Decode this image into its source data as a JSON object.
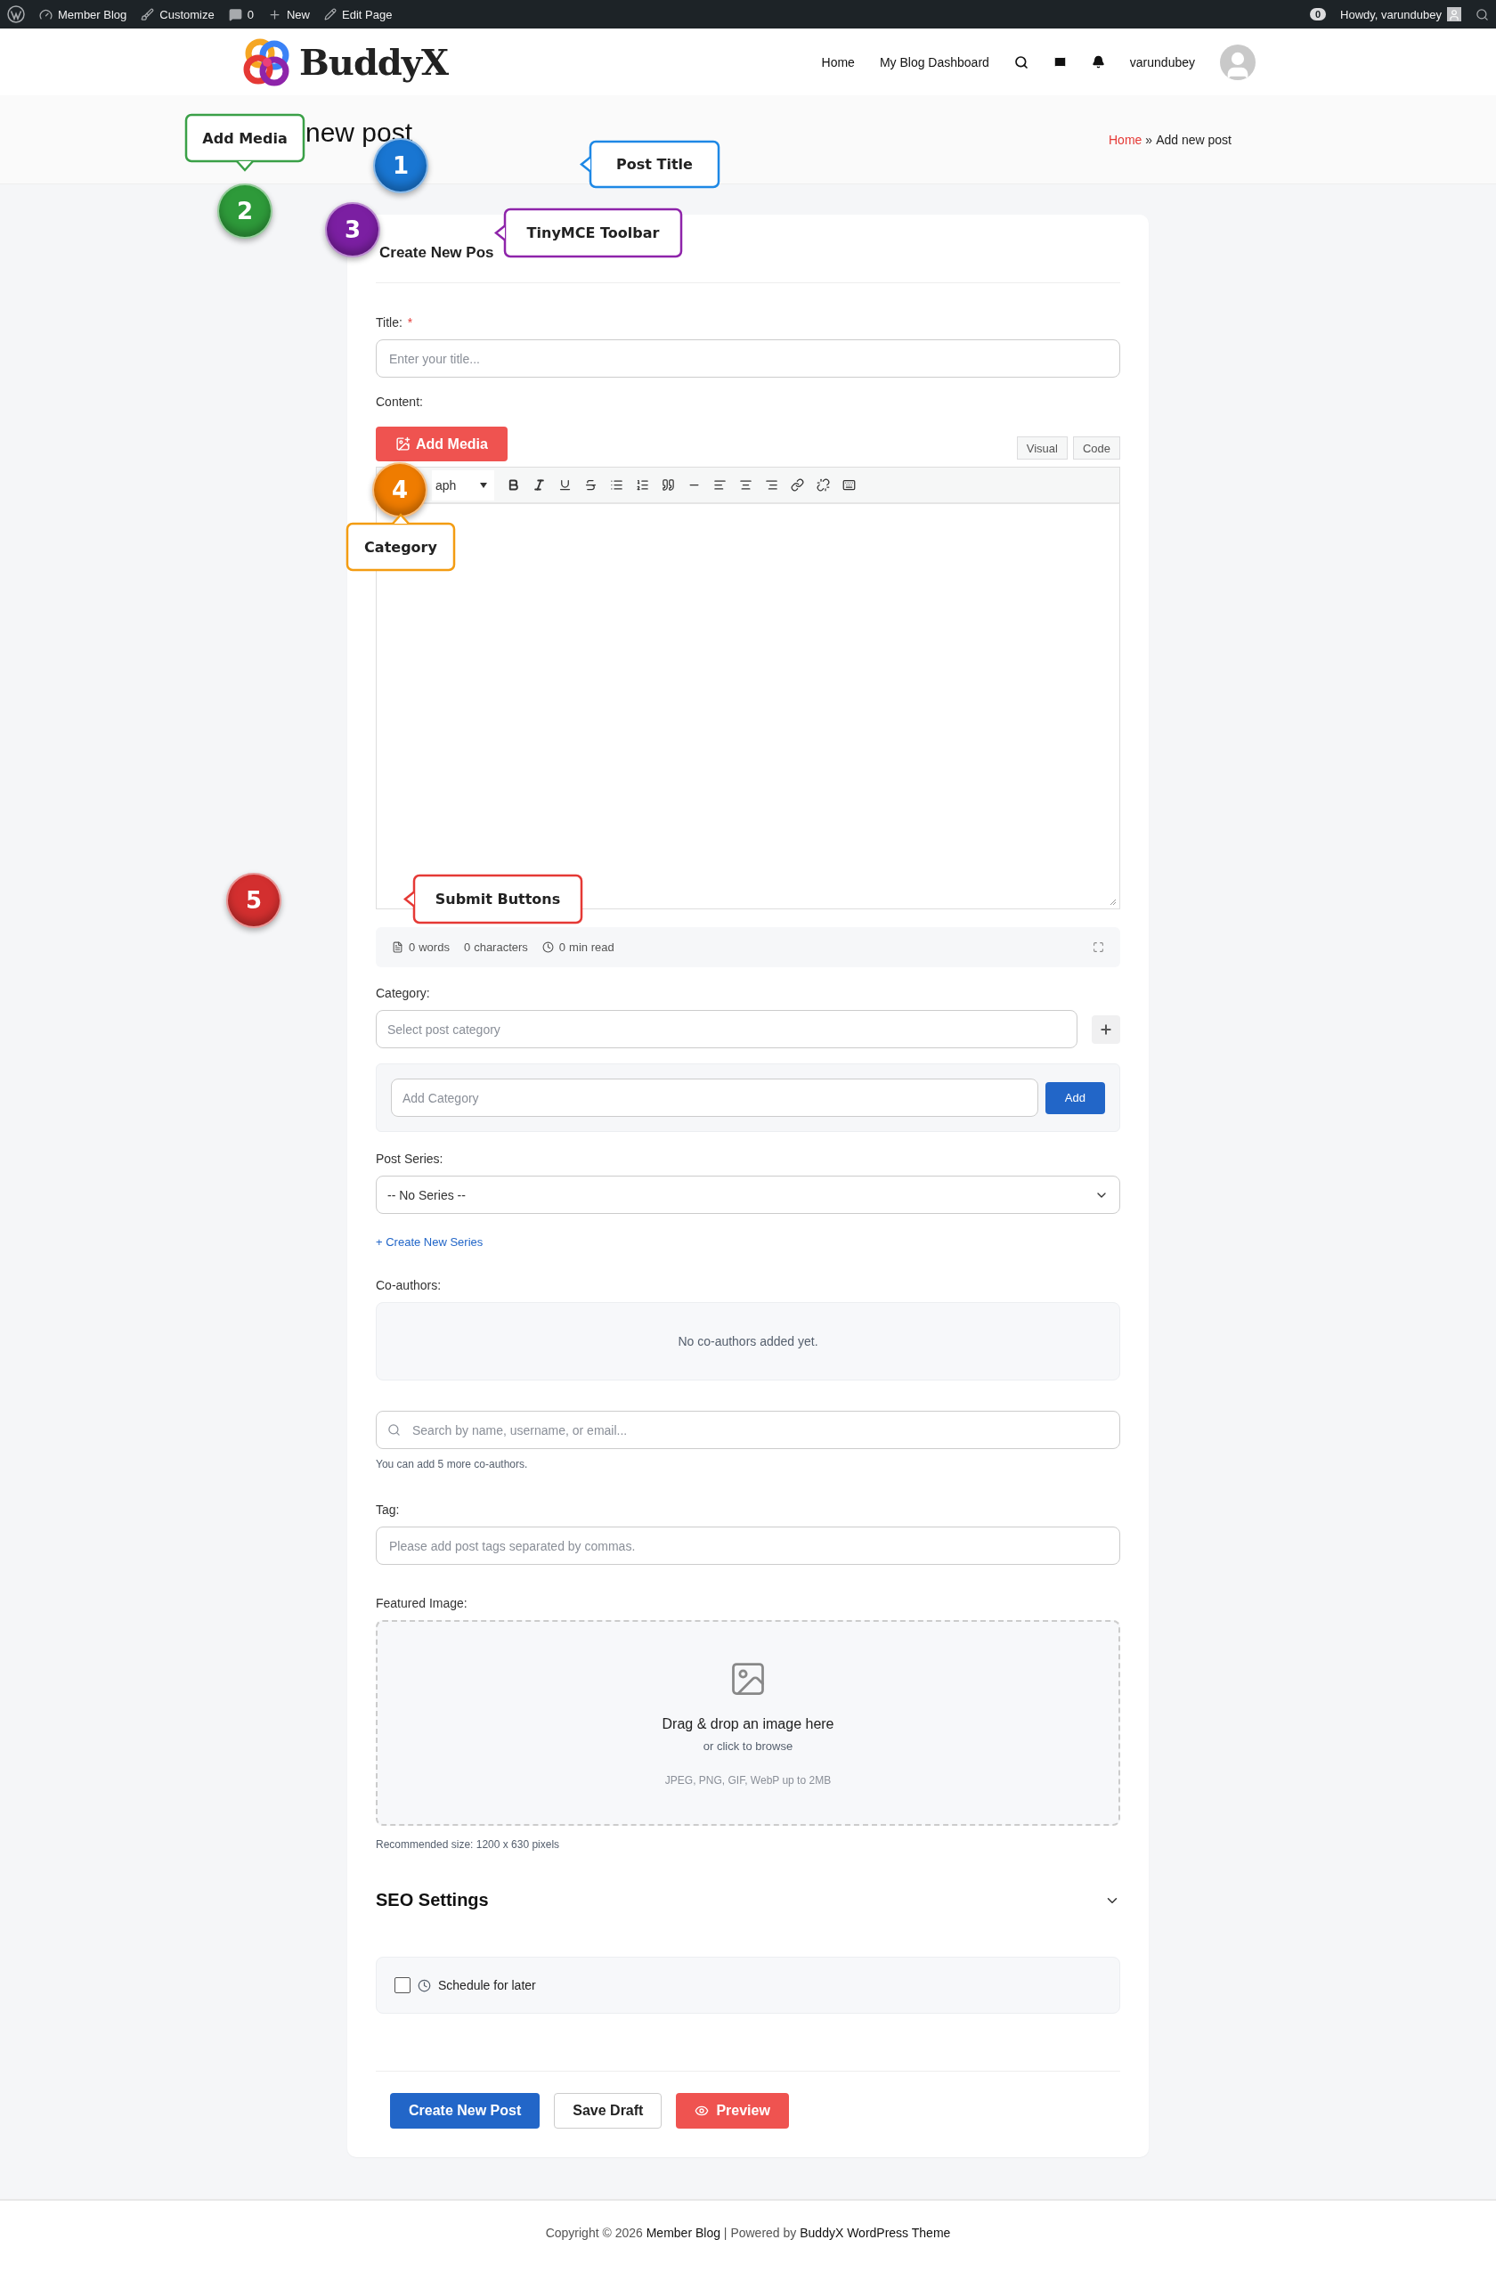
{
  "admin_bar": {
    "site": "Member Blog",
    "customize": "Customize",
    "comments": "0",
    "new": "New",
    "edit": "Edit Page",
    "notifications": "0",
    "greeting": "Howdy, varundubey"
  },
  "header": {
    "logo": "BuddyX",
    "nav": [
      "Home",
      "My Blog Dashboard"
    ],
    "username": "varundubey"
  },
  "page_title": "new post",
  "breadcrumb": {
    "link": "Home",
    "separator": "»",
    "current": "Add new post"
  },
  "form": {
    "title": "Create New Pos",
    "title_field": {
      "label": "Title:",
      "required_mark": "*",
      "placeholder": "Enter your title..."
    },
    "content": {
      "label": "Content:",
      "add_media": "Add Media",
      "modes": [
        "Visual",
        "Code"
      ],
      "format": "aph",
      "stats": [
        {
          "value": "0",
          "unit": "words"
        },
        {
          "value": "0",
          "unit": "characters"
        },
        {
          "value": "0",
          "unit": "min read"
        }
      ]
    },
    "category": {
      "label": "Category:",
      "placeholder": "Select post category",
      "add_placeholder": "Add Category",
      "add_button": "Add"
    },
    "series": {
      "label": "Post Series:",
      "value": "-- No Series --",
      "create_link": "+ Create New Series"
    },
    "coauthors": {
      "label": "Co-authors:",
      "empty": "No co-authors added yet.",
      "search_placeholder": "Search by name, username, or email...",
      "hint": "You can add 5 more co-authors."
    },
    "tag": {
      "label": "Tag:",
      "placeholder": "Please add post tags separated by commas."
    },
    "featured_image": {
      "label": "Featured Image:",
      "title": "Drag & drop an image here",
      "subtitle": "or click to browse",
      "formats": "JPEG, PNG, GIF, WebP up to 2MB",
      "hint": "Recommended size: 1200 x 630 pixels"
    },
    "seo": {
      "title": "SEO Settings",
      "expanded": false
    },
    "schedule": {
      "label": "Schedule for later",
      "checked": false
    },
    "buttons": [
      {
        "label": "Create New Post",
        "kind": "primary"
      },
      {
        "label": "Save Draft",
        "kind": "secondary"
      },
      {
        "label": "Preview",
        "kind": "danger"
      }
    ]
  },
  "footer": {
    "text": "Copyright © 2026",
    "site": "Member Blog",
    "separator": "| Powered by",
    "theme": "BuddyX WordPress Theme"
  },
  "markers": [
    {
      "number": "1",
      "color": "#1976d2"
    },
    {
      "number": "2",
      "color": "#2e9a3a"
    },
    {
      "number": "3",
      "color": "#7b1fa2"
    },
    {
      "number": "4",
      "color": "#ef7c00"
    },
    {
      "number": "5",
      "color": "#d32f2f"
    }
  ],
  "callouts": [
    {
      "text": "Add Media",
      "color": "#3aa047"
    },
    {
      "text": "Post Title",
      "color": "#1e88e5"
    },
    {
      "text": "TinyMCE Toolbar",
      "color": "#8e24aa"
    },
    {
      "text": "Category",
      "color": "#f39c12"
    },
    {
      "text": "Submit Buttons",
      "color": "#e53935"
    }
  ]
}
